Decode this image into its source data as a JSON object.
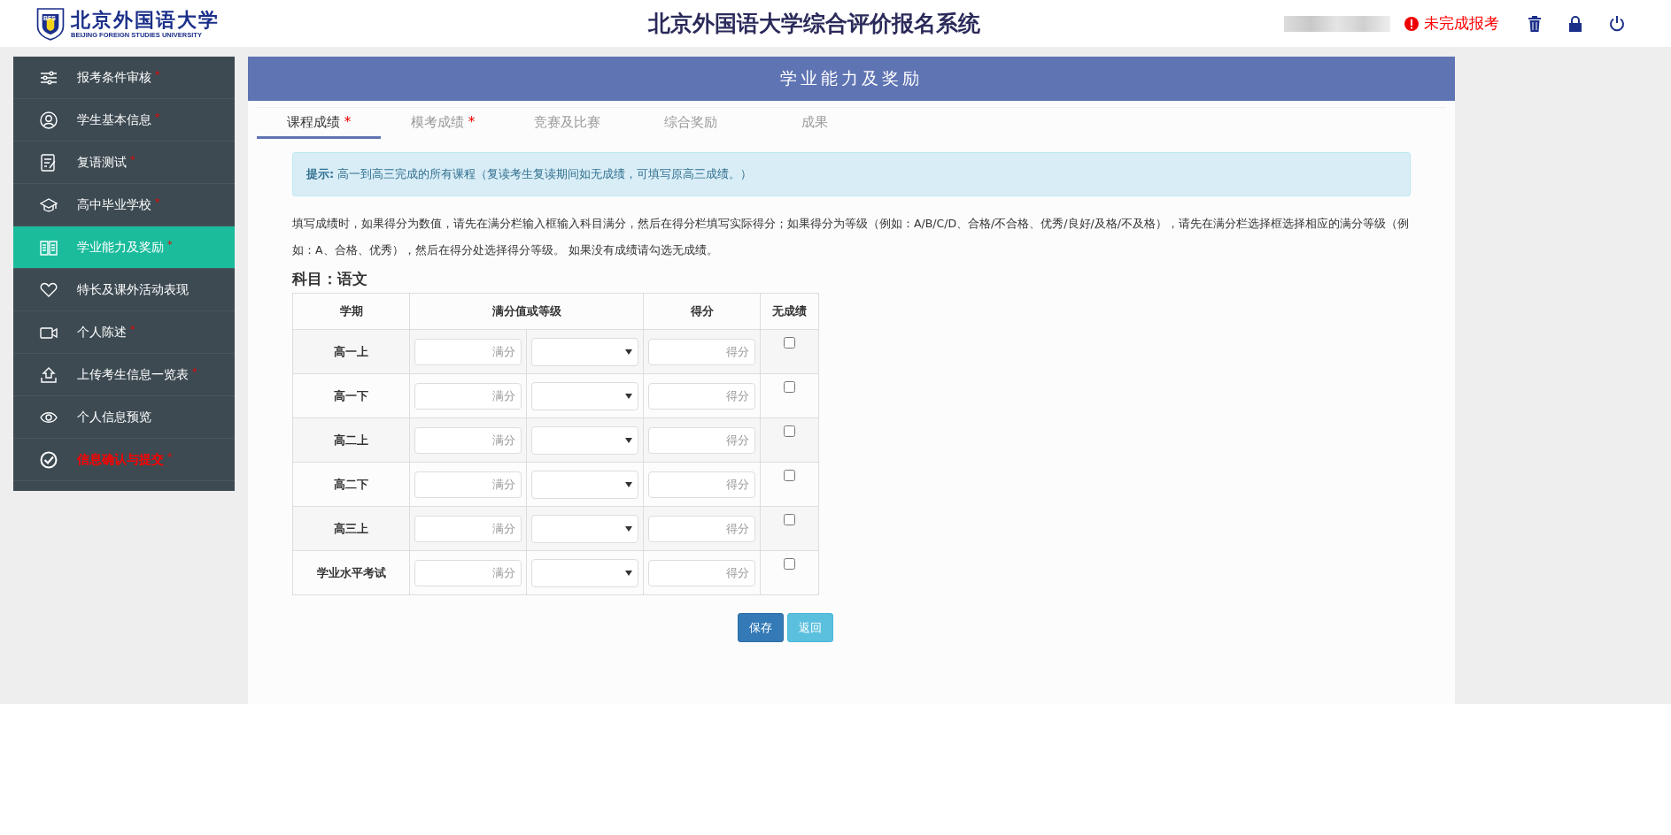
{
  "header": {
    "logo_name_cn": "北京外国语大学",
    "logo_name_en": "BEIJING FOREIGN STUDIES UNIVERSITY",
    "logo_badge": "BFS",
    "title": "北京外国语大学综合评价报名系统",
    "status": "未完成报考"
  },
  "sidebar": {
    "items": [
      {
        "label": "报考条件审核",
        "required_mark": "*",
        "selected": false,
        "alert": false
      },
      {
        "label": "学生基本信息",
        "required_mark": "*",
        "selected": false,
        "alert": false
      },
      {
        "label": "复语测试",
        "required_mark": "*",
        "selected": false,
        "alert": false
      },
      {
        "label": "高中毕业学校",
        "required_mark": "*",
        "selected": false,
        "alert": false
      },
      {
        "label": "学业能力及奖励",
        "required_mark": "*",
        "selected": true,
        "alert": false
      },
      {
        "label": "特长及课外活动表现",
        "selected": false,
        "alert": false
      },
      {
        "label": "个人陈述",
        "required_mark": "*",
        "selected": false,
        "alert": false
      },
      {
        "label": "上传考生信息一览表",
        "required_mark": "*",
        "selected": false,
        "alert": false
      },
      {
        "label": "个人信息预览",
        "selected": false,
        "alert": false
      },
      {
        "label": "信息确认与提交",
        "required_mark": "*",
        "selected": false,
        "alert": true
      }
    ]
  },
  "panel": {
    "title": "学业能力及奖励",
    "tabs": [
      {
        "label": "课程成绩",
        "required_mark": "*",
        "selected": true
      },
      {
        "label": "模考成绩",
        "required_mark": "*",
        "selected": false
      },
      {
        "label": "竞赛及比赛",
        "selected": false
      },
      {
        "label": "综合奖励",
        "selected": false
      },
      {
        "label": "成果",
        "selected": false
      }
    ],
    "hint": "**提示:** 高一到高三完成的所有课程（复读考生复读期间如无成绩，可填写原高三成绩。）",
    "instructions": "填写成绩时，如果得分为数值，请先在满分栏输入框输入科目满分，然后在得分栏填写实际得分；如果得分为等级（例如：A/B/C/D、合格/不合格、优秀/良好/及格/不及格），请先在满分栏选择框选择相应的满分等级（例如：A、合格、优秀），然后在得分处选择得分等级。 如果没有成绩请勾选无成绩。",
    "subject": "科目：语文",
    "table": {
      "columns": [
        "学期",
        "满分值或等级",
        "得分",
        "无成绩"
      ],
      "rows": [
        {
          "term": "高一上",
          "full_placeholder": "满分",
          "score_placeholder": "得分",
          "no_score": false
        },
        {
          "term": "高一下",
          "full_placeholder": "满分",
          "score_placeholder": "得分",
          "no_score": false
        },
        {
          "term": "高二上",
          "full_placeholder": "满分",
          "score_placeholder": "得分",
          "no_score": false
        },
        {
          "term": "高二下",
          "full_placeholder": "满分",
          "score_placeholder": "得分",
          "no_score": false
        },
        {
          "term": "高三上",
          "full_placeholder": "满分",
          "score_placeholder": "得分",
          "no_score": false
        },
        {
          "term": "学业水平考试",
          "full_placeholder": "满分",
          "score_placeholder": "得分",
          "no_score": false
        }
      ]
    },
    "buttons": [
      {
        "label": "保存",
        "kind": "primary"
      },
      {
        "label": "返回",
        "kind": "secondary"
      }
    ]
  }
}
